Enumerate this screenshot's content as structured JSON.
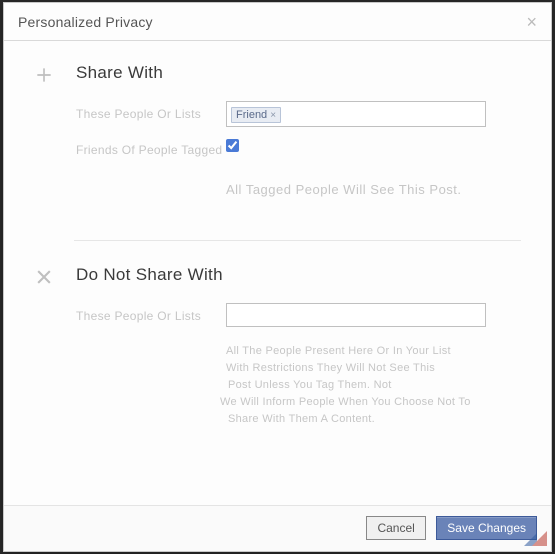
{
  "modal": {
    "title": "Personalized Privacy",
    "close_glyph": "×"
  },
  "share": {
    "title": "Share With",
    "people_label": "These People Or Lists",
    "tag_value": "Friend",
    "tag_close": "×",
    "friends_tagged_label": "Friends Of People Tagged",
    "tagged_checked": true,
    "note": "All Tagged People Will See This Post."
  },
  "deny": {
    "title": "Do Not Share With",
    "people_label": "These People Or Lists",
    "input_value": "",
    "note_l1": "All The People Present Here Or In Your List",
    "note_l2": "With Restrictions They Will Not See This",
    "note_l3": "Post Unless You Tag Them. Not",
    "note_l4": "We Will Inform People When You Choose Not To",
    "note_l5": "Share With Them A Content."
  },
  "footer": {
    "cancel": "Cancel",
    "save": "Save Changes"
  }
}
